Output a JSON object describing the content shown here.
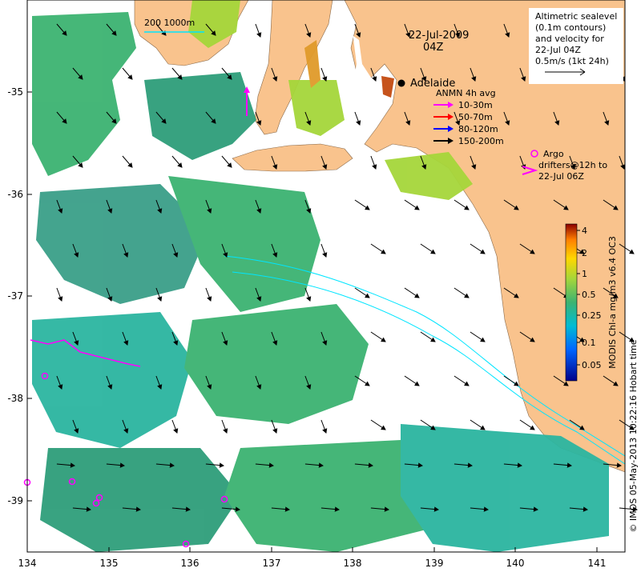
{
  "date_title": "22-Jul-2009",
  "time_title": "04Z",
  "scale_label": "200   1000m",
  "city": "Adelaide",
  "legend_topright": [
    "Altimetric sealevel",
    "(0.1m contours)",
    "and velocity for",
    "22-Jul 04Z",
    "0.5m/s (1kt 24h)"
  ],
  "anmn": {
    "title": "ANMN 4h avg",
    "items": [
      {
        "label": "10-30m",
        "color": "#ff00ff"
      },
      {
        "label": "50-70m",
        "color": "#ff0000"
      },
      {
        "label": "80-120m",
        "color": "#0000ff"
      },
      {
        "label": "150-200m",
        "color": "#000000"
      }
    ]
  },
  "argo": {
    "line1": "Argo",
    "line2": "drifters@12h to",
    "line3": "22-Jul 06Z",
    "color": "#ff00ff"
  },
  "colorbar": {
    "ticks": [
      "4",
      "2",
      "1",
      "0.5",
      "0.25",
      "0.1",
      "0.05"
    ],
    "label": "MODIS Chl-a mg/m3 v6.4 OC3"
  },
  "credit": "© IMOS 05-May-2013 10:22:16 Hobart time",
  "x_ticks": [
    "134",
    "135",
    "136",
    "137",
    "138",
    "139",
    "140",
    "141"
  ],
  "y_ticks": [
    "-35",
    "-36",
    "-37",
    "-38",
    "-39"
  ],
  "colors": {
    "land": "#f9c38d",
    "sea": "#ffffff",
    "contour": "#00e5ff",
    "chl_low": "#2e9e7a",
    "chl_mid": "#3cb371",
    "chl_high": "#a5d63a"
  }
}
